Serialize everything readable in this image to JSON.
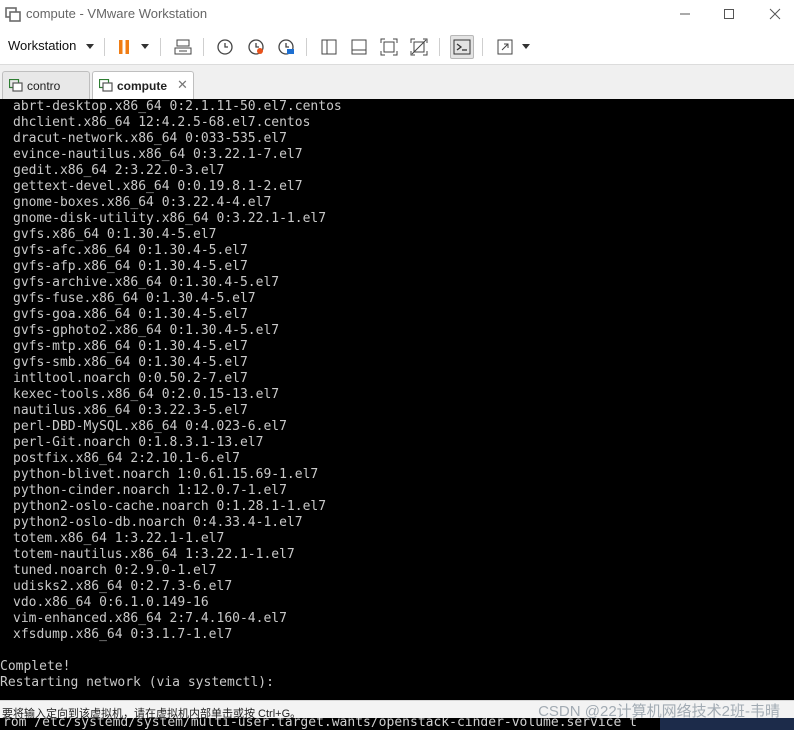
{
  "window": {
    "title": "compute - VMware Workstation",
    "icons": {
      "app": "vmware-icon",
      "minimize": "minimize-icon",
      "maximize": "maximize-icon",
      "close": "close-icon"
    }
  },
  "toolbar": {
    "menu_label": "Workstation",
    "buttons": [
      "pause-icon",
      "send-keys-icon",
      "snapshot-icon",
      "revert-snapshot-icon",
      "snapshot-manager-icon",
      "library-icon",
      "thumbnail-icon",
      "fullscreen-icon",
      "unity-icon",
      "console-view-icon",
      "stretch-icon"
    ]
  },
  "tabs": [
    {
      "label": "contro",
      "active": false
    },
    {
      "label": "compute",
      "active": true
    }
  ],
  "console": {
    "lines": [
      "abrt-desktop.x86_64 0:2.1.11-50.el7.centos",
      "dhclient.x86_64 12:4.2.5-68.el7.centos",
      "dracut-network.x86_64 0:033-535.el7",
      "evince-nautilus.x86_64 0:3.22.1-7.el7",
      "gedit.x86_64 2:3.22.0-3.el7",
      "gettext-devel.x86_64 0:0.19.8.1-2.el7",
      "gnome-boxes.x86_64 0:3.22.4-4.el7",
      "gnome-disk-utility.x86_64 0:3.22.1-1.el7",
      "gvfs.x86_64 0:1.30.4-5.el7",
      "gvfs-afc.x86_64 0:1.30.4-5.el7",
      "gvfs-afp.x86_64 0:1.30.4-5.el7",
      "gvfs-archive.x86_64 0:1.30.4-5.el7",
      "gvfs-fuse.x86_64 0:1.30.4-5.el7",
      "gvfs-goa.x86_64 0:1.30.4-5.el7",
      "gvfs-gphoto2.x86_64 0:1.30.4-5.el7",
      "gvfs-mtp.x86_64 0:1.30.4-5.el7",
      "gvfs-smb.x86_64 0:1.30.4-5.el7",
      "intltool.noarch 0:0.50.2-7.el7",
      "kexec-tools.x86_64 0:2.0.15-13.el7",
      "nautilus.x86_64 0:3.22.3-5.el7",
      "perl-DBD-MySQL.x86_64 0:4.023-6.el7",
      "perl-Git.noarch 0:1.8.3.1-13.el7",
      "postfix.x86_64 2:2.10.1-6.el7",
      "python-blivet.noarch 1:0.61.15.69-1.el7",
      "python-cinder.noarch 1:12.0.7-1.el7",
      "python2-oslo-cache.noarch 0:1.28.1-1.el7",
      "python2-oslo-db.noarch 0:4.33.4-1.el7",
      "totem.x86_64 1:3.22.1-1.el7",
      "totem-nautilus.x86_64 1:3.22.1-1.el7",
      "tuned.noarch 0:2.9.0-1.el7",
      "udisks2.x86_64 0:2.7.3-6.el7",
      "vdo.x86_64 0:6.1.0.149-16",
      "vim-enhanced.x86_64 2:7.4.160-4.el7",
      "xfsdump.x86_64 0:3.1.7-1.el7",
      "",
      "Complete!",
      "Restarting network (via systemctl):"
    ]
  },
  "status": {
    "hint": "要将输入定向到该虚拟机，请在虚拟机内部单击或按 Ctrl+G。",
    "command": "rom /etc/systemd/system/multi-user.target.wants/openstack-cinder-volume.service t"
  },
  "watermark": "CSDN @22计算机网络技术2班-韦晴"
}
